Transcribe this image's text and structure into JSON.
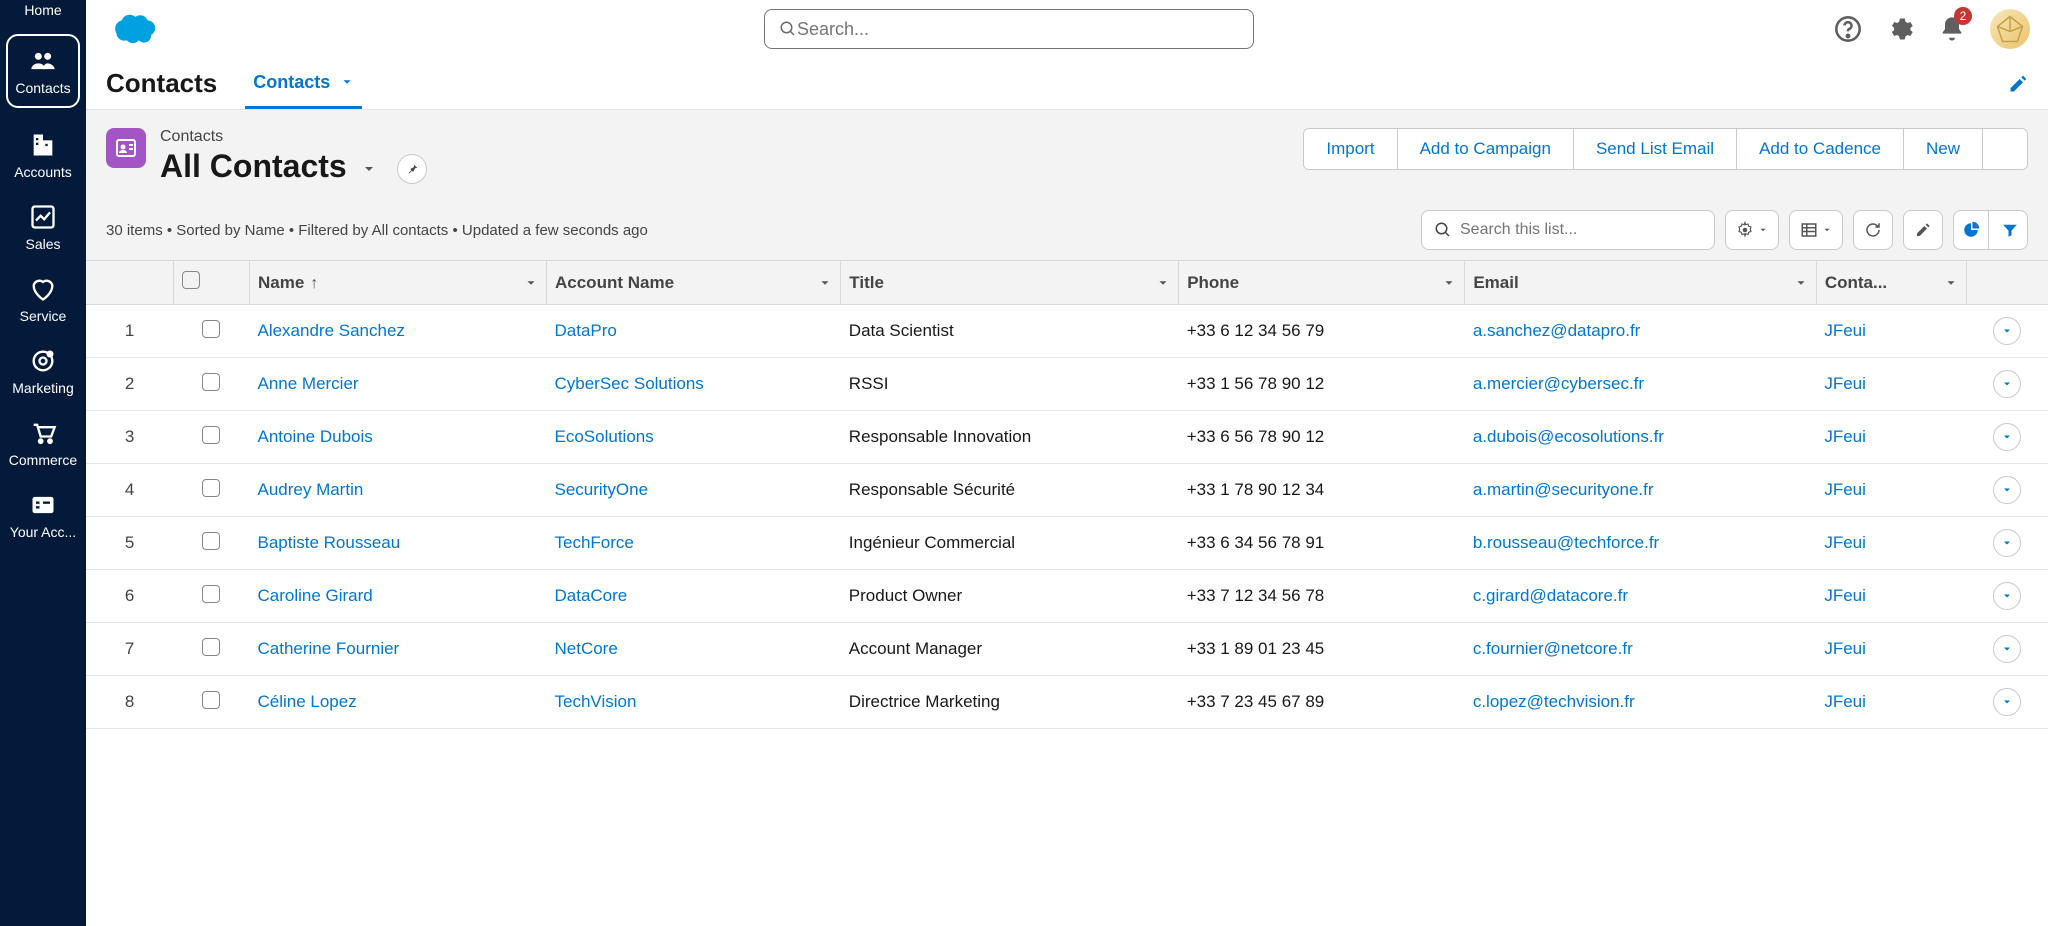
{
  "nav": {
    "items": [
      {
        "label": "Home"
      },
      {
        "label": "Contacts"
      },
      {
        "label": "Accounts"
      },
      {
        "label": "Sales"
      },
      {
        "label": "Service"
      },
      {
        "label": "Marketing"
      },
      {
        "label": "Commerce"
      },
      {
        "label": "Your Acc..."
      }
    ]
  },
  "topbar": {
    "search_placeholder": "Search...",
    "notification_count": "2"
  },
  "subhead": {
    "title": "Contacts",
    "tab_label": "Contacts"
  },
  "listview": {
    "object_label": "Contacts",
    "title": "All Contacts",
    "info": "30 items • Sorted by Name • Filtered by All contacts • Updated a few seconds ago",
    "search_placeholder": "Search this list...",
    "actions": {
      "import": "Import",
      "add_to_campaign": "Add to Campaign",
      "send_list_email": "Send List Email",
      "add_to_cadence": "Add to Cadence",
      "new": "New"
    }
  },
  "table": {
    "columns": {
      "name": "Name",
      "account": "Account Name",
      "title": "Title",
      "phone": "Phone",
      "email": "Email",
      "owner": "Conta..."
    },
    "rows": [
      {
        "n": "1",
        "name": "Alexandre Sanchez",
        "account": "DataPro",
        "title": "Data Scientist",
        "phone": "+33 6 12 34 56 79",
        "email": "a.sanchez@datapro.fr",
        "owner": "JFeui"
      },
      {
        "n": "2",
        "name": "Anne Mercier",
        "account": "CyberSec Solutions",
        "title": "RSSI",
        "phone": "+33 1 56 78 90 12",
        "email": "a.mercier@cybersec.fr",
        "owner": "JFeui"
      },
      {
        "n": "3",
        "name": "Antoine Dubois",
        "account": "EcoSolutions",
        "title": "Responsable Innovation",
        "phone": "+33 6 56 78 90 12",
        "email": "a.dubois@ecosolutions.fr",
        "owner": "JFeui"
      },
      {
        "n": "4",
        "name": "Audrey Martin",
        "account": "SecurityOne",
        "title": "Responsable Sécurité",
        "phone": "+33 1 78 90 12 34",
        "email": "a.martin@securityone.fr",
        "owner": "JFeui"
      },
      {
        "n": "5",
        "name": "Baptiste Rousseau",
        "account": "TechForce",
        "title": "Ingénieur Commercial",
        "phone": "+33 6 34 56 78 91",
        "email": "b.rousseau@techforce.fr",
        "owner": "JFeui"
      },
      {
        "n": "6",
        "name": "Caroline Girard",
        "account": "DataCore",
        "title": "Product Owner",
        "phone": "+33 7 12 34 56 78",
        "email": "c.girard@datacore.fr",
        "owner": "JFeui"
      },
      {
        "n": "7",
        "name": "Catherine Fournier",
        "account": "NetCore",
        "title": "Account Manager",
        "phone": "+33 1 89 01 23 45",
        "email": "c.fournier@netcore.fr",
        "owner": "JFeui"
      },
      {
        "n": "8",
        "name": "Céline Lopez",
        "account": "TechVision",
        "title": "Directrice Marketing",
        "phone": "+33 7 23 45 67 89",
        "email": "c.lopez@techvision.fr",
        "owner": "JFeui"
      }
    ]
  }
}
